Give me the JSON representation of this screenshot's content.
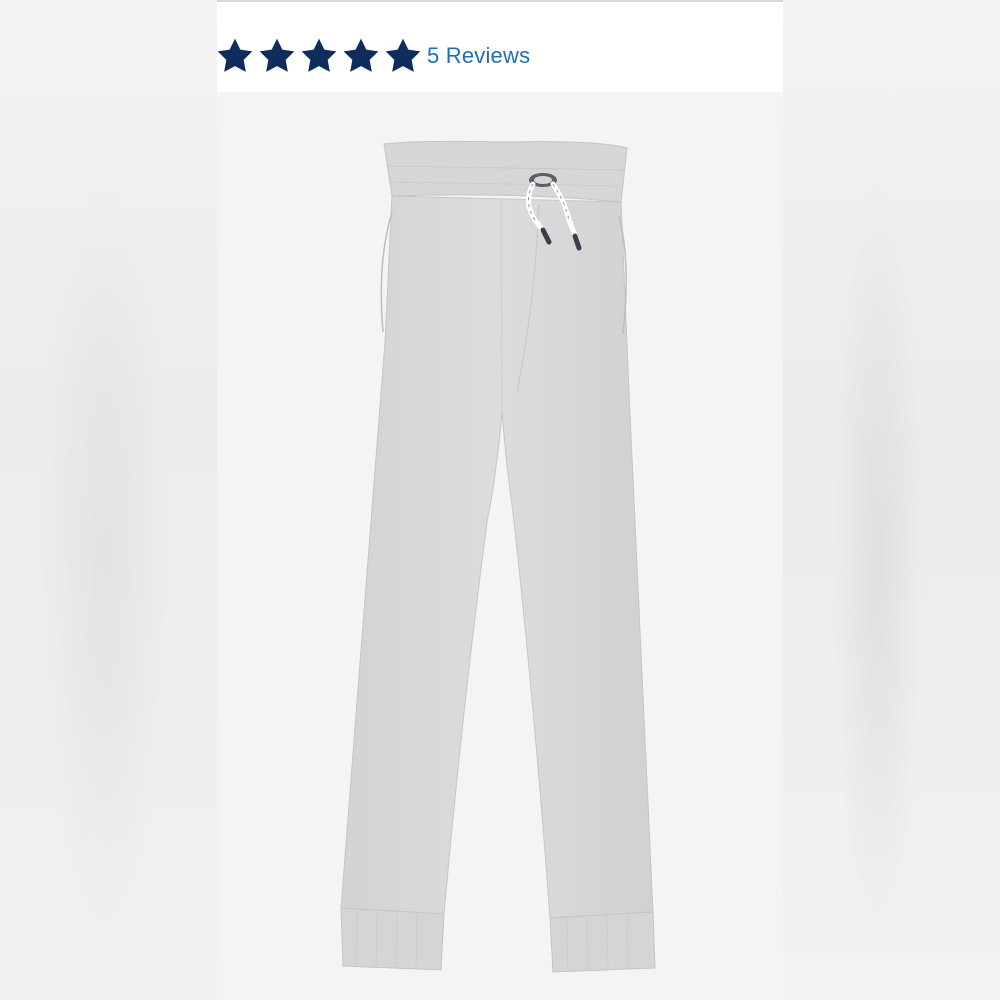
{
  "rating": {
    "stars_filled": 5,
    "stars_total": 5,
    "reviews_label": "5 Reviews",
    "star_color": "#0f2d5c"
  },
  "product": {
    "image_icon": "sweatpants-image",
    "fabric_color": "#d9d9d9",
    "drawstring_color": "#ffffff",
    "tip_color": "#3a3f4a"
  },
  "colors": {
    "link": "#1f6fb2",
    "background": "#f4f4f4"
  }
}
